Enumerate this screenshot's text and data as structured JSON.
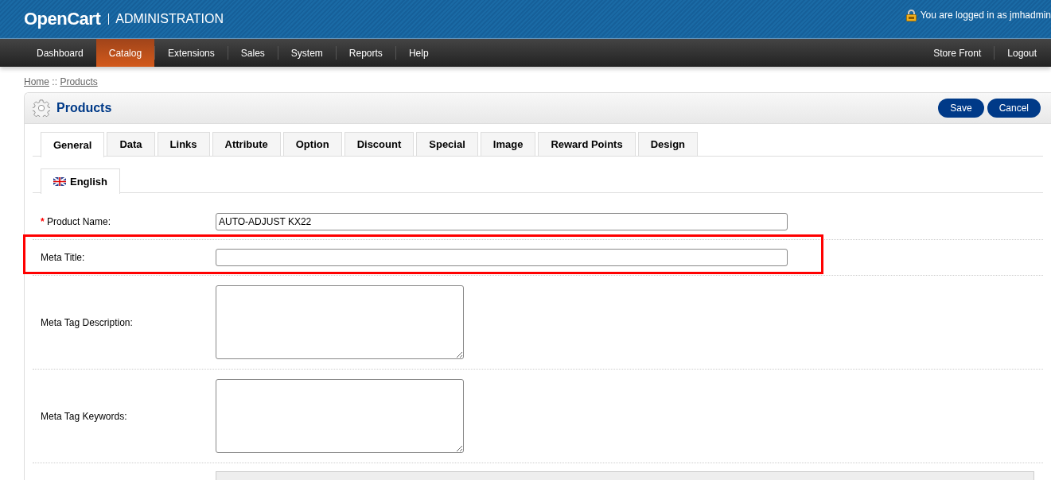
{
  "header": {
    "logo": "OpenCart",
    "title": "ADMINISTRATION",
    "login_text": "You are logged in as jmhadmin"
  },
  "menu": [
    {
      "label": "Dashboard",
      "selected": false
    },
    {
      "label": "Catalog",
      "selected": true
    },
    {
      "label": "Extensions",
      "selected": false
    },
    {
      "label": "Sales",
      "selected": false
    },
    {
      "label": "System",
      "selected": false
    },
    {
      "label": "Reports",
      "selected": false
    },
    {
      "label": "Help",
      "selected": false
    }
  ],
  "menu_right": [
    "Store Front",
    "Logout"
  ],
  "breadcrumb": {
    "items": [
      "Home",
      "Products"
    ],
    "separator": "::"
  },
  "panel": {
    "title": "Products",
    "buttons": [
      "Save",
      "Cancel"
    ]
  },
  "tabs": [
    {
      "label": "General",
      "selected": true
    },
    {
      "label": "Data",
      "selected": false
    },
    {
      "label": "Links",
      "selected": false
    },
    {
      "label": "Attribute",
      "selected": false
    },
    {
      "label": "Option",
      "selected": false
    },
    {
      "label": "Discount",
      "selected": false
    },
    {
      "label": "Special",
      "selected": false
    },
    {
      "label": "Image",
      "selected": false
    },
    {
      "label": "Reward Points",
      "selected": false
    },
    {
      "label": "Design",
      "selected": false
    }
  ],
  "language_tabs": [
    {
      "label": "English",
      "selected": true
    }
  ],
  "fields": [
    {
      "kind": "text",
      "label": "Product Name:",
      "required_mark": "*",
      "value": "AUTO-ADJUST KX22",
      "highlighted": false
    },
    {
      "kind": "text",
      "label": "Meta Title:",
      "highlighted": true
    },
    {
      "kind": "textarea",
      "label": "Meta Tag Description:",
      "highlighted": false
    },
    {
      "kind": "textarea",
      "label": "Meta Tag Keywords:",
      "highlighted": false
    },
    {
      "kind": "editor",
      "highlighted": false
    }
  ]
}
